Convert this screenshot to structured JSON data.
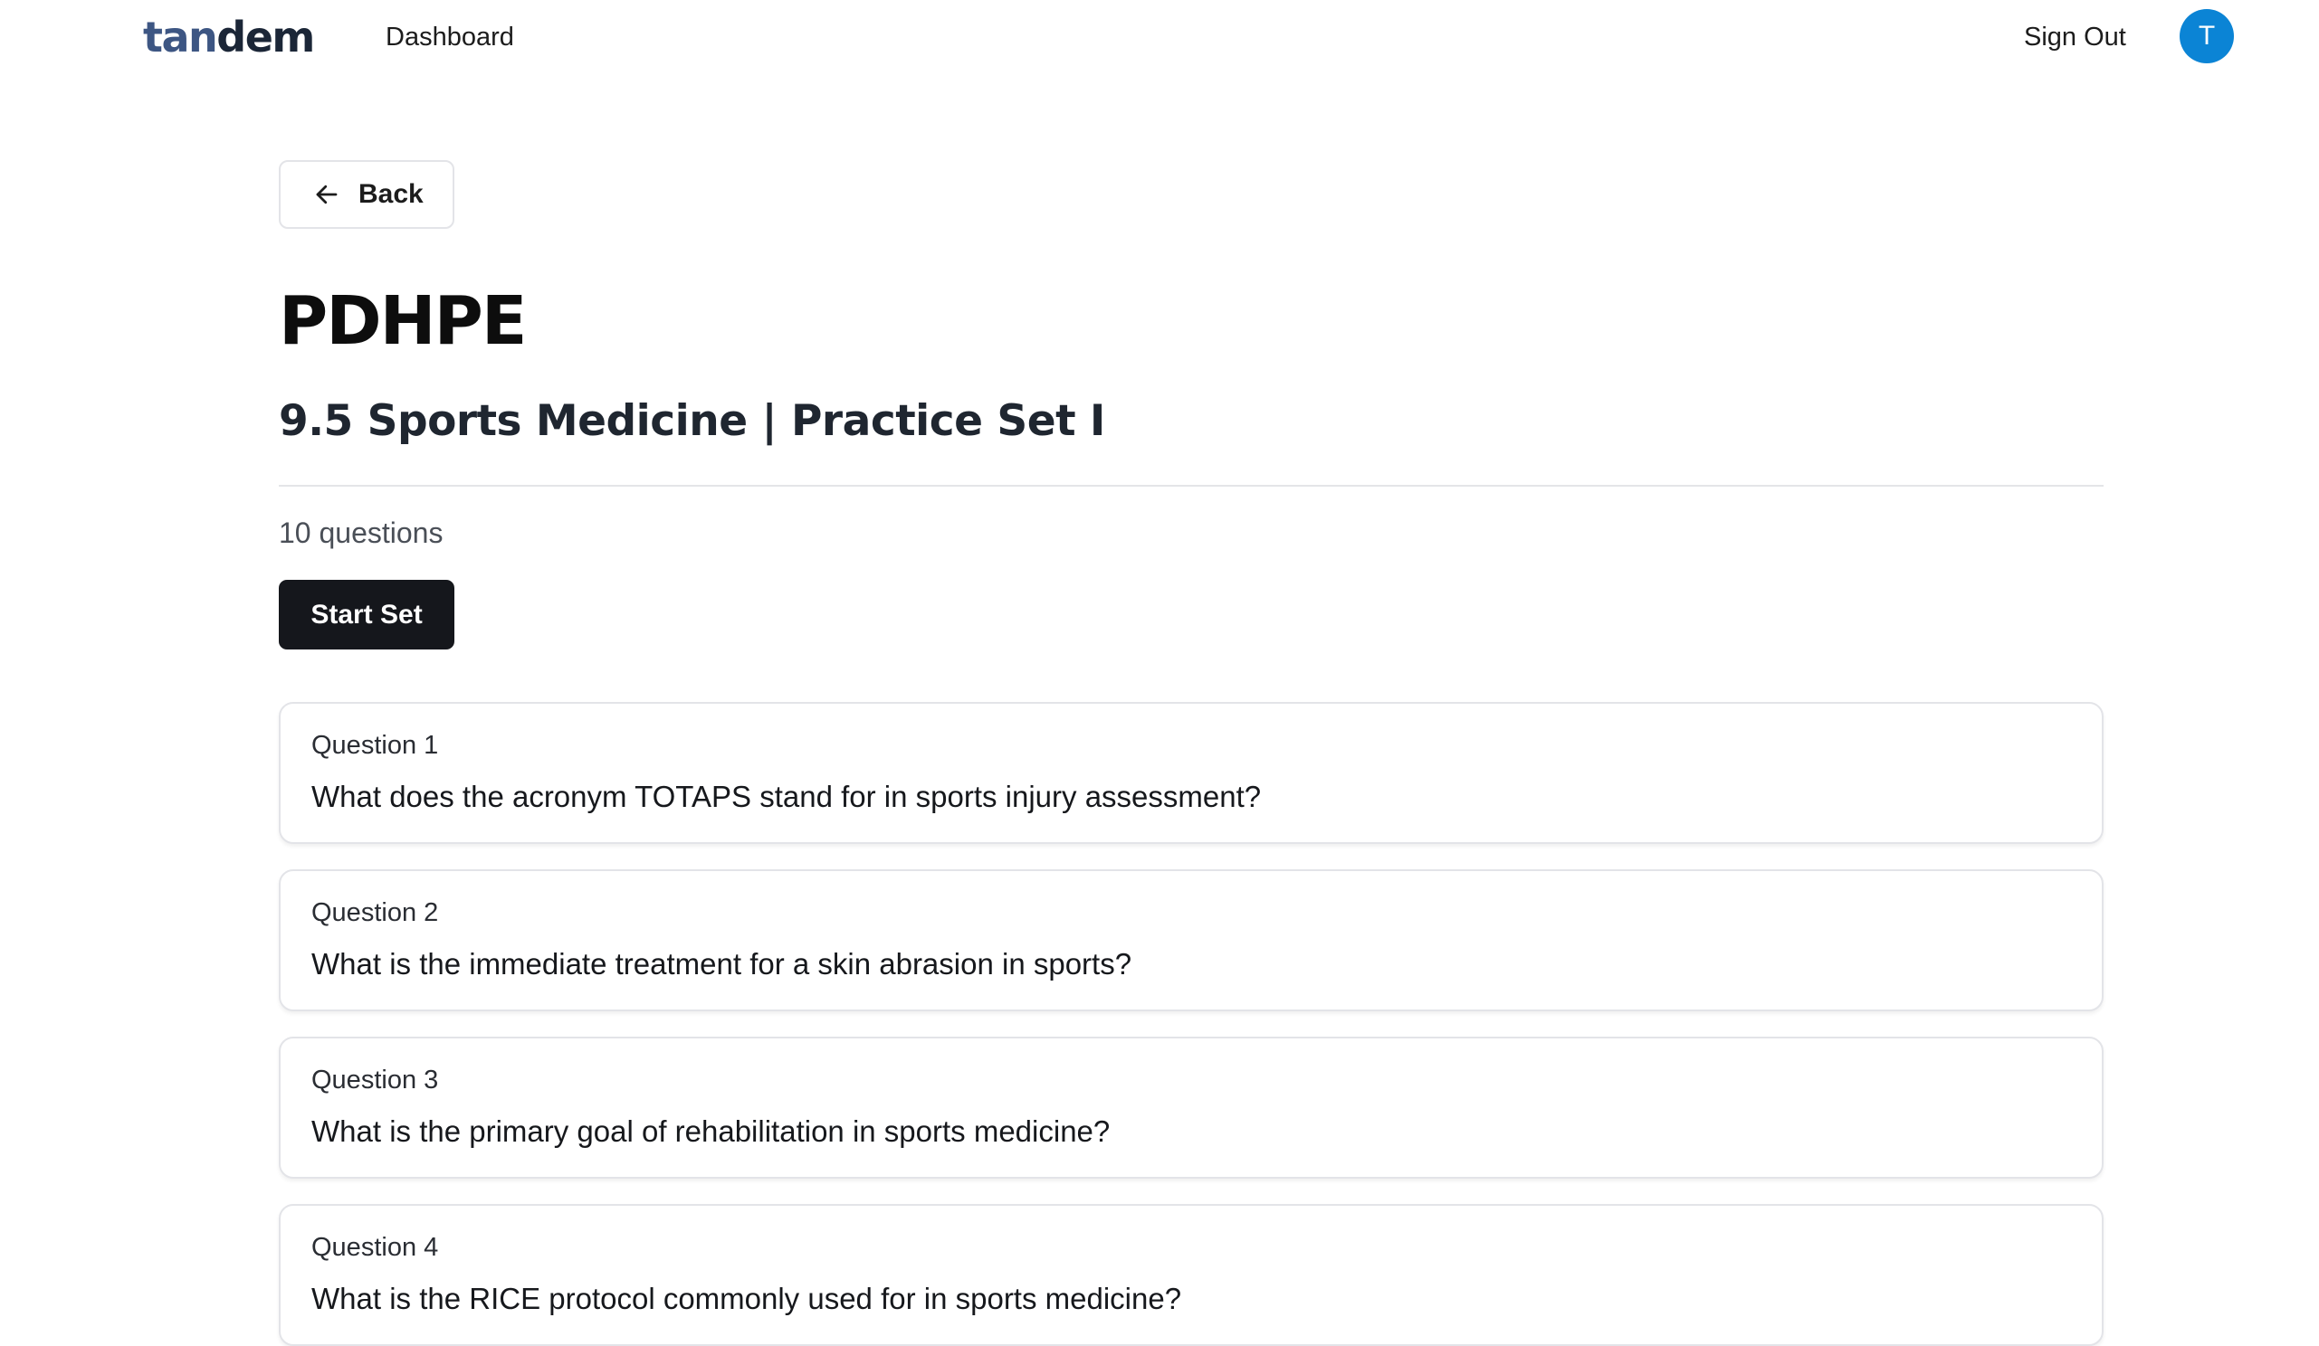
{
  "nav": {
    "logo_part_a": "tan",
    "logo_part_b": "dem",
    "dashboard": "Dashboard",
    "sign_out": "Sign Out",
    "avatar_initial": "T"
  },
  "page": {
    "back_label": "Back",
    "subject": "PDHPE",
    "set_title": "9.5 Sports Medicine | Practice Set I",
    "question_count": "10 questions",
    "start_label": "Start Set"
  },
  "questions": [
    {
      "label": "Question 1",
      "text": "What does the acronym TOTAPS stand for in sports injury assessment?"
    },
    {
      "label": "Question 2",
      "text": "What is the immediate treatment for a skin abrasion in sports?"
    },
    {
      "label": "Question 3",
      "text": "What is the primary goal of rehabilitation in sports medicine?"
    },
    {
      "label": "Question 4",
      "text": "What is the RICE protocol commonly used for in sports medicine?"
    }
  ],
  "colors": {
    "logo_light": "#3d5683",
    "logo_dark": "#1b2637",
    "avatar_bg": "#0b84d5",
    "primary_button": "#15171c",
    "border": "#e3e4e8"
  },
  "icons": {
    "back": "arrow-left-icon"
  }
}
